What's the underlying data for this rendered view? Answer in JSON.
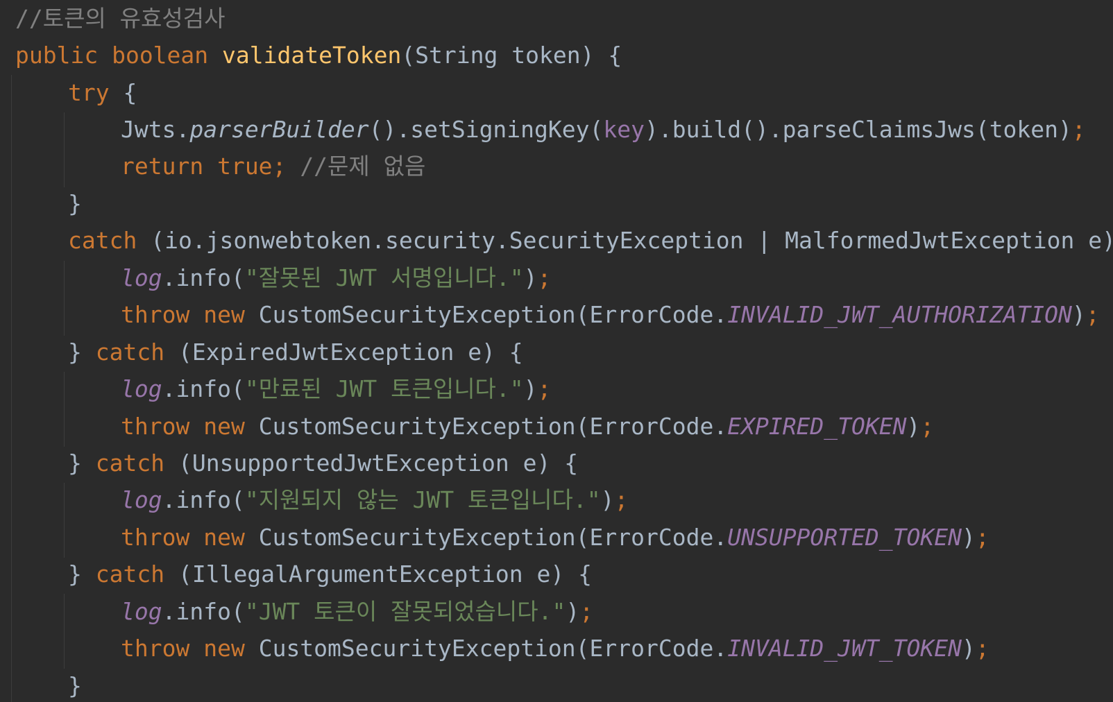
{
  "lines": [
    {
      "indent": 0,
      "tokens": [
        {
          "text": "//토큰의 유효성검사",
          "kind": "comment"
        }
      ]
    },
    {
      "indent": 0,
      "tokens": [
        {
          "text": "public ",
          "kind": "keyword"
        },
        {
          "text": "boolean ",
          "kind": "keyword"
        },
        {
          "text": "validateToken",
          "kind": "method-decl"
        },
        {
          "text": "(String token) {",
          "kind": "plain"
        }
      ]
    },
    {
      "indent": 1,
      "tokens": [
        {
          "text": "try ",
          "kind": "keyword"
        },
        {
          "text": "{",
          "kind": "plain"
        }
      ]
    },
    {
      "indent": 2,
      "tokens": [
        {
          "text": "Jwts.",
          "kind": "plain"
        },
        {
          "text": "parserBuilder",
          "kind": "static-method"
        },
        {
          "text": "().setSigningKey(",
          "kind": "plain"
        },
        {
          "text": "key",
          "kind": "field"
        },
        {
          "text": ").build().parseClaimsJws(token)",
          "kind": "plain"
        },
        {
          "text": ";",
          "kind": "keyword"
        }
      ]
    },
    {
      "indent": 2,
      "tokens": [
        {
          "text": "return ",
          "kind": "keyword"
        },
        {
          "text": "true",
          "kind": "keyword"
        },
        {
          "text": "; ",
          "kind": "keyword"
        },
        {
          "text": "//문제 없음",
          "kind": "comment"
        }
      ]
    },
    {
      "indent": 1,
      "tokens": [
        {
          "text": "}",
          "kind": "plain"
        }
      ]
    },
    {
      "indent": 1,
      "tokens": [
        {
          "text": "catch ",
          "kind": "keyword"
        },
        {
          "text": "(io.jsonwebtoken.security.SecurityException | MalformedJwtException e) {",
          "kind": "plain"
        }
      ]
    },
    {
      "indent": 2,
      "tokens": [
        {
          "text": "log",
          "kind": "static-field"
        },
        {
          "text": ".info(",
          "kind": "plain"
        },
        {
          "text": "\"잘못된 JWT 서명입니다.\"",
          "kind": "string"
        },
        {
          "text": ")",
          "kind": "plain"
        },
        {
          "text": ";",
          "kind": "keyword"
        }
      ]
    },
    {
      "indent": 2,
      "tokens": [
        {
          "text": "throw ",
          "kind": "keyword"
        },
        {
          "text": "new ",
          "kind": "keyword"
        },
        {
          "text": "CustomSecurityException(ErrorCode.",
          "kind": "plain"
        },
        {
          "text": "INVALID_JWT_AUTHORIZATION",
          "kind": "constant"
        },
        {
          "text": ")",
          "kind": "plain"
        },
        {
          "text": ";",
          "kind": "keyword"
        }
      ]
    },
    {
      "indent": 1,
      "tokens": [
        {
          "text": "} ",
          "kind": "plain"
        },
        {
          "text": "catch ",
          "kind": "keyword"
        },
        {
          "text": "(ExpiredJwtException e) {",
          "kind": "plain"
        }
      ]
    },
    {
      "indent": 2,
      "tokens": [
        {
          "text": "log",
          "kind": "static-field"
        },
        {
          "text": ".info(",
          "kind": "plain"
        },
        {
          "text": "\"만료된 JWT 토큰입니다.\"",
          "kind": "string"
        },
        {
          "text": ")",
          "kind": "plain"
        },
        {
          "text": ";",
          "kind": "keyword"
        }
      ]
    },
    {
      "indent": 2,
      "tokens": [
        {
          "text": "throw ",
          "kind": "keyword"
        },
        {
          "text": "new ",
          "kind": "keyword"
        },
        {
          "text": "CustomSecurityException(ErrorCode.",
          "kind": "plain"
        },
        {
          "text": "EXPIRED_TOKEN",
          "kind": "constant"
        },
        {
          "text": ")",
          "kind": "plain"
        },
        {
          "text": ";",
          "kind": "keyword"
        }
      ]
    },
    {
      "indent": 1,
      "tokens": [
        {
          "text": "} ",
          "kind": "plain"
        },
        {
          "text": "catch ",
          "kind": "keyword"
        },
        {
          "text": "(UnsupportedJwtException e) {",
          "kind": "plain"
        }
      ]
    },
    {
      "indent": 2,
      "tokens": [
        {
          "text": "log",
          "kind": "static-field"
        },
        {
          "text": ".info(",
          "kind": "plain"
        },
        {
          "text": "\"지원되지 않는 JWT 토큰입니다.\"",
          "kind": "string"
        },
        {
          "text": ")",
          "kind": "plain"
        },
        {
          "text": ";",
          "kind": "keyword"
        }
      ]
    },
    {
      "indent": 2,
      "tokens": [
        {
          "text": "throw ",
          "kind": "keyword"
        },
        {
          "text": "new ",
          "kind": "keyword"
        },
        {
          "text": "CustomSecurityException(ErrorCode.",
          "kind": "plain"
        },
        {
          "text": "UNSUPPORTED_TOKEN",
          "kind": "constant"
        },
        {
          "text": ")",
          "kind": "plain"
        },
        {
          "text": ";",
          "kind": "keyword"
        }
      ]
    },
    {
      "indent": 1,
      "tokens": [
        {
          "text": "} ",
          "kind": "plain"
        },
        {
          "text": "catch ",
          "kind": "keyword"
        },
        {
          "text": "(IllegalArgumentException e) {",
          "kind": "plain"
        }
      ]
    },
    {
      "indent": 2,
      "tokens": [
        {
          "text": "log",
          "kind": "static-field"
        },
        {
          "text": ".info(",
          "kind": "plain"
        },
        {
          "text": "\"JWT 토큰이 잘못되었습니다.\"",
          "kind": "string"
        },
        {
          "text": ")",
          "kind": "plain"
        },
        {
          "text": ";",
          "kind": "keyword"
        }
      ]
    },
    {
      "indent": 2,
      "tokens": [
        {
          "text": "throw ",
          "kind": "keyword"
        },
        {
          "text": "new ",
          "kind": "keyword"
        },
        {
          "text": "CustomSecurityException(ErrorCode.",
          "kind": "plain"
        },
        {
          "text": "INVALID_JWT_TOKEN",
          "kind": "constant"
        },
        {
          "text": ")",
          "kind": "plain"
        },
        {
          "text": ";",
          "kind": "keyword"
        }
      ]
    },
    {
      "indent": 1,
      "tokens": [
        {
          "text": "}",
          "kind": "plain"
        }
      ]
    }
  ],
  "colors": {
    "background": "#2b2b2b",
    "keyword": "#cc7832",
    "method_declaration": "#ffc66d",
    "plain": "#a9b7c6",
    "comment": "#808080",
    "string": "#6a8759",
    "field_constant": "#9876aa",
    "indent_guide": "#3d3d3d"
  }
}
